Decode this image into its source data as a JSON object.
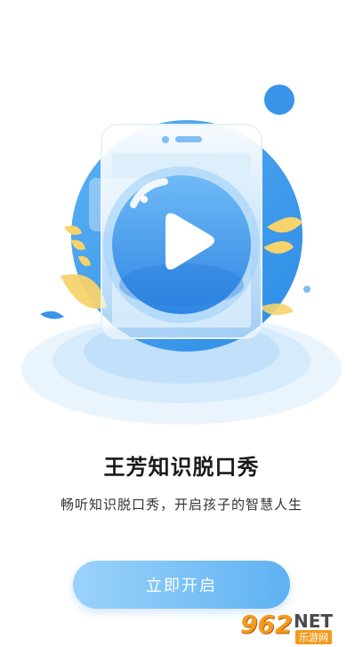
{
  "splash": {
    "title": "王芳知识脱口秀",
    "subtitle": "畅听知识脱口秀，开启孩子的智慧人生",
    "start_button_label": "立即开启"
  },
  "watermark": {
    "logo_text": "962",
    "net_text": "NET",
    "sub_text": "乐游网"
  },
  "colors": {
    "accent": "#5fb1f3",
    "accent_light": "#9bd3fa",
    "leaf": "#f6d36b"
  },
  "icons": [
    "play-icon",
    "leaf-icon"
  ]
}
